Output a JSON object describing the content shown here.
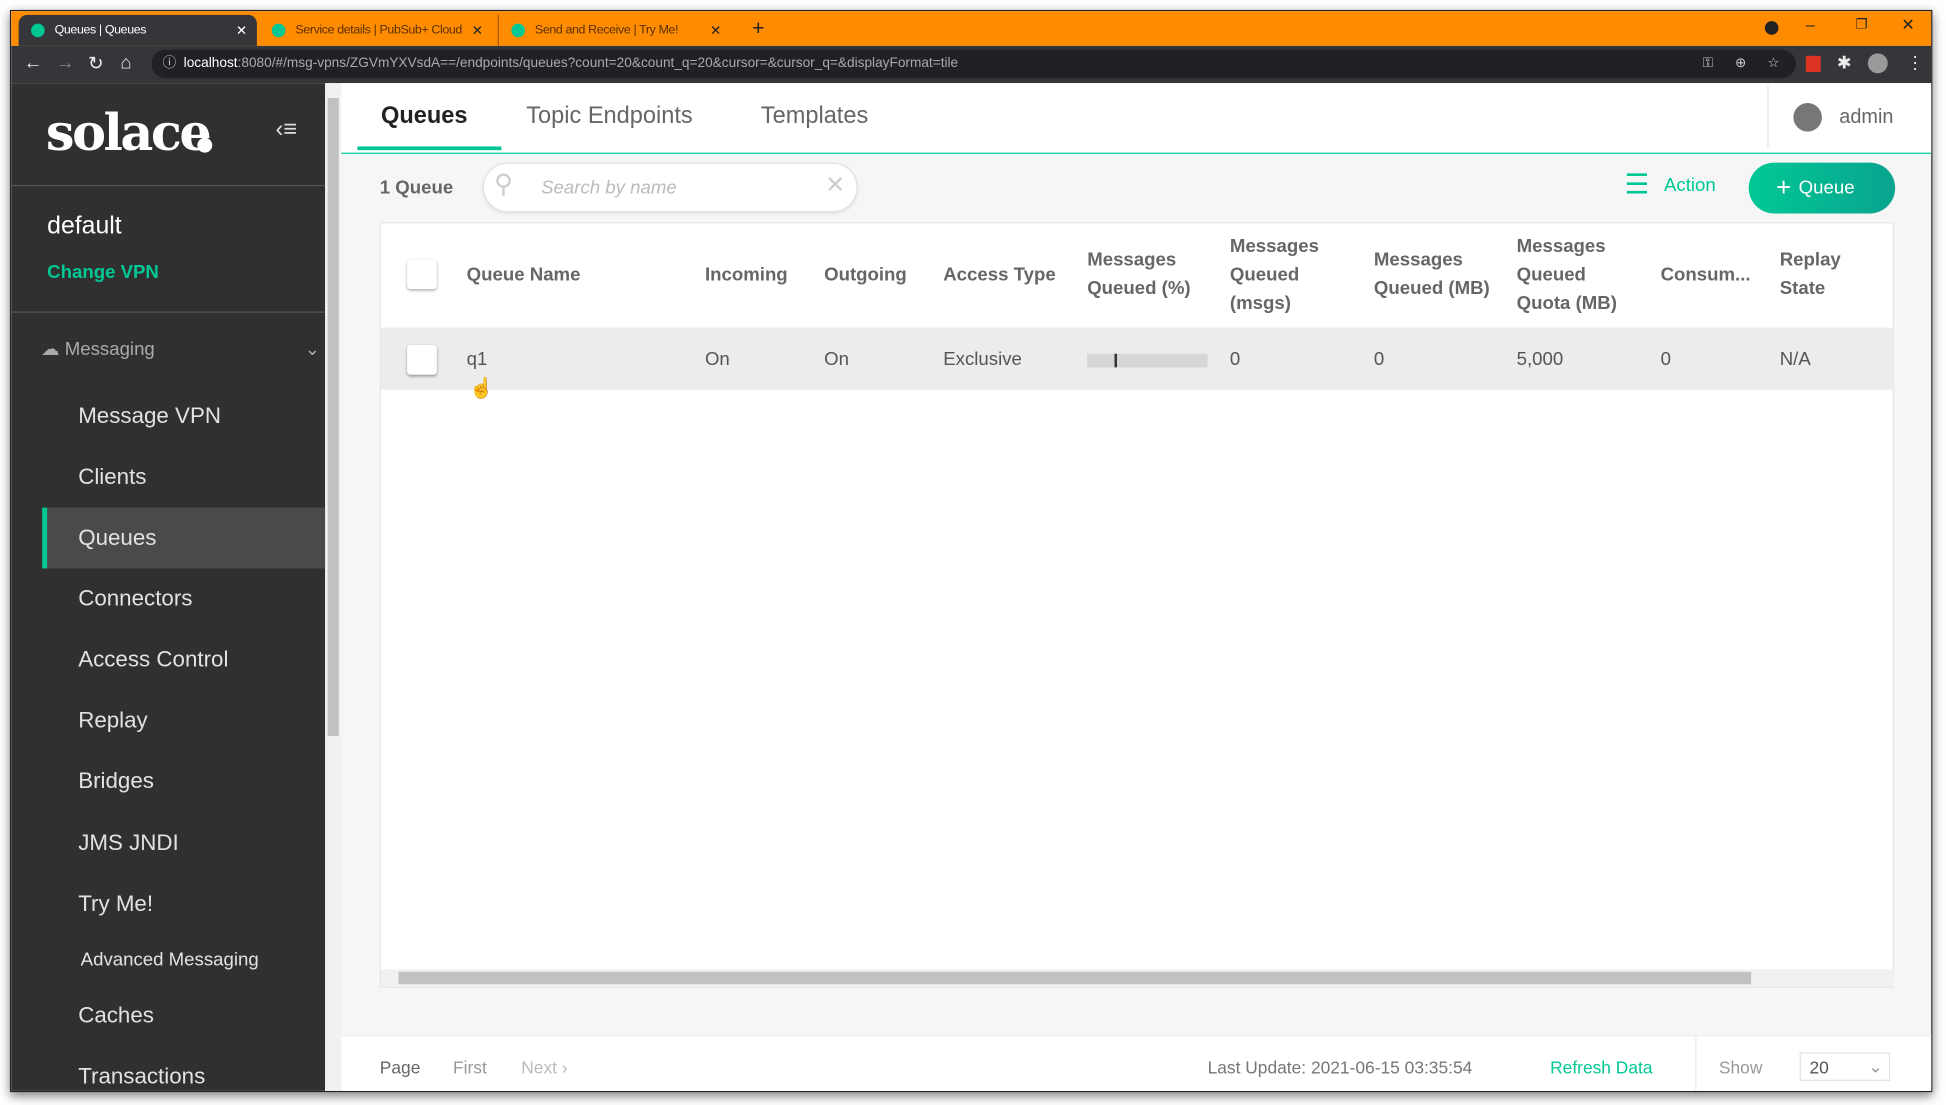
{
  "browser": {
    "tabs": [
      {
        "title": "Queues | Queues"
      },
      {
        "title": "Service details | PubSub+ Cloud"
      },
      {
        "title": "Send and Receive | Try Me!"
      }
    ],
    "url_host": "localhost",
    "url_rest": ":8080/#/msg-vpns/ZGVmYXVsdA==/endpoints/queues?count=20&count_q=20&cursor=&cursor_q=&displayFormat=tile"
  },
  "sidebar": {
    "logo": "solace",
    "vpn_name": "default",
    "change_vpn": "Change VPN",
    "section": "Messaging",
    "items": [
      {
        "label": "Message VPN"
      },
      {
        "label": "Clients"
      },
      {
        "label": "Queues",
        "active": true
      },
      {
        "label": "Connectors"
      },
      {
        "label": "Access Control"
      },
      {
        "label": "Replay"
      },
      {
        "label": "Bridges"
      },
      {
        "label": "JMS JNDI"
      },
      {
        "label": "Try Me!"
      },
      {
        "label": "Advanced Messaging"
      },
      {
        "label": "Caches"
      },
      {
        "label": "Transactions"
      }
    ]
  },
  "header": {
    "tabs": [
      "Queues",
      "Topic Endpoints",
      "Templates"
    ],
    "user": "admin"
  },
  "toolbar": {
    "count": "1 Queue",
    "search_placeholder": "Search by name",
    "action": "Action",
    "add": "Queue"
  },
  "table": {
    "columns": [
      [
        "Queue Name"
      ],
      [
        "Incoming"
      ],
      [
        "Outgoing"
      ],
      [
        "Access Type"
      ],
      [
        "Messages",
        "Queued (%)"
      ],
      [
        "Messages",
        "Queued",
        "(msgs)"
      ],
      [
        "Messages",
        "Queued (MB)"
      ],
      [
        "Messages",
        "Queued",
        "Quota (MB)"
      ],
      [
        "Consum..."
      ],
      [
        "Replay",
        "State"
      ]
    ],
    "rows": [
      {
        "name": "q1",
        "incoming": "On",
        "outgoing": "On",
        "access": "Exclusive",
        "queued_pct": 0,
        "msgs": "0",
        "mb": "0",
        "quota": "5,000",
        "consumers": "0",
        "replay": "N/A"
      }
    ]
  },
  "footer": {
    "page": "Page",
    "first": "First",
    "next": "Next",
    "last_update": "Last Update: 2021-06-15 03:35:54",
    "refresh": "Refresh Data",
    "show": "Show",
    "show_value": "20"
  },
  "colors": {
    "accent": "#00c895",
    "tabbar": "#ff8c00",
    "sidebar": "#303030"
  }
}
